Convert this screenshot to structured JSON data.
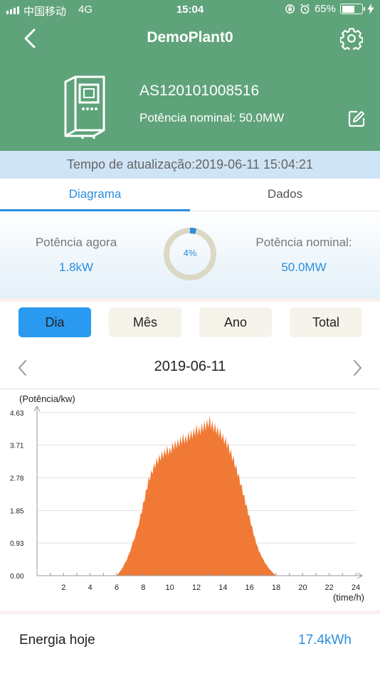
{
  "status_bar": {
    "carrier": "中国移动",
    "network": "4G",
    "time": "15:04",
    "battery": "65%",
    "battery_level": 0.65
  },
  "header": {
    "title": "DemoPlant0",
    "back_icon": "chevron-left-icon",
    "settings_icon": "gear-icon"
  },
  "device": {
    "serial": "AS120101008516",
    "nominal_power": "Potência nominal: 50.0MW",
    "icon": "inverter-icon",
    "edit_icon": "edit-icon"
  },
  "update_time": "Tempo de atualização:2019-06-11 15:04:21",
  "tabs": [
    {
      "label": "Diagrama",
      "active": true
    },
    {
      "label": "Dados",
      "active": false
    }
  ],
  "power": {
    "current_label": "Potência agora",
    "current_value": "1.8kW",
    "percent": "4%",
    "percent_value": 4,
    "nominal_label": "Potência nominal:",
    "nominal_value": "50.0MW"
  },
  "periods": [
    {
      "label": "Dia",
      "active": true
    },
    {
      "label": "Mês",
      "active": false
    },
    {
      "label": "Ano",
      "active": false
    },
    {
      "label": "Total",
      "active": false
    }
  ],
  "date": "2019-06-11",
  "chart_data": {
    "type": "area",
    "ylabel": "(Potência/kw)",
    "xlabel": "(time/h)",
    "xlim": [
      0,
      24
    ],
    "ylim": [
      0,
      4.63
    ],
    "yticks": [
      "0.00",
      "0.93",
      "1.85",
      "2.78",
      "3.71",
      "4.63"
    ],
    "xticks": [
      "2",
      "4",
      "6",
      "8",
      "10",
      "12",
      "14",
      "16",
      "18",
      "20",
      "22",
      "24"
    ],
    "color": "#f07a35",
    "series": [
      {
        "x": [
          6.0,
          6.3,
          6.6,
          6.9,
          7.2,
          7.5,
          7.8,
          8.0,
          8.2,
          8.4,
          8.6,
          8.8,
          9.0,
          9.2,
          9.4,
          9.6,
          9.8,
          10.0,
          10.2,
          10.4,
          10.6,
          10.8,
          11.0,
          11.2,
          11.4,
          11.6,
          11.8,
          12.0,
          12.2,
          12.4,
          12.6,
          12.8,
          13.0,
          13.2,
          13.4,
          13.6,
          13.8,
          14.0,
          14.2,
          14.4,
          14.6,
          14.8,
          15.0,
          15.2,
          15.4,
          15.6,
          15.8,
          16.0,
          16.2,
          16.4,
          16.6,
          16.8,
          17.0,
          17.3,
          17.6,
          18.0
        ],
        "y": [
          0.0,
          0.15,
          0.35,
          0.6,
          0.95,
          1.3,
          1.75,
          2.1,
          2.45,
          2.8,
          3.0,
          3.2,
          3.35,
          3.45,
          3.55,
          3.6,
          3.7,
          3.65,
          3.8,
          3.85,
          3.9,
          3.95,
          4.05,
          4.0,
          4.1,
          4.15,
          4.2,
          4.3,
          4.25,
          4.35,
          4.4,
          4.45,
          4.55,
          4.4,
          4.35,
          4.25,
          4.2,
          4.05,
          3.95,
          3.8,
          3.6,
          3.4,
          3.15,
          2.9,
          2.6,
          2.3,
          2.0,
          1.7,
          1.4,
          1.1,
          0.85,
          0.65,
          0.5,
          0.3,
          0.15,
          0.0
        ]
      }
    ]
  },
  "energy": {
    "label": "Energia hoje",
    "value": "17.4kWh"
  }
}
